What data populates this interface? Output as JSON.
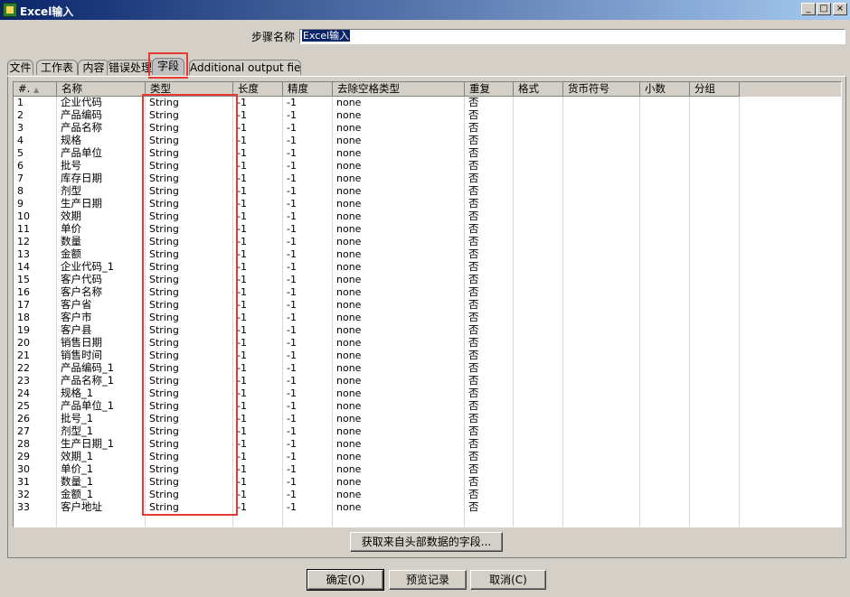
{
  "window": {
    "title": "Excel输入",
    "minimize": "_",
    "maximize": "□",
    "close": "×"
  },
  "step": {
    "label": "步骤名称",
    "value": "Excel输入"
  },
  "tabs": [
    "文件",
    "工作表",
    "内容",
    "错误处理",
    "字段",
    "Additional output fields"
  ],
  "active_tab": "字段",
  "grid": {
    "columns": [
      "#.",
      "名称",
      "类型",
      "长度",
      "精度",
      "去除空格类型",
      "重复",
      "格式",
      "货币符号",
      "小数",
      "分组"
    ],
    "rows": [
      [
        "1",
        "企业代码",
        "String",
        "-1",
        "-1",
        "none",
        "否"
      ],
      [
        "2",
        "产品编码",
        "String",
        "-1",
        "-1",
        "none",
        "否"
      ],
      [
        "3",
        "产品名称",
        "String",
        "-1",
        "-1",
        "none",
        "否"
      ],
      [
        "4",
        "规格",
        "String",
        "-1",
        "-1",
        "none",
        "否"
      ],
      [
        "5",
        "产品单位",
        "String",
        "-1",
        "-1",
        "none",
        "否"
      ],
      [
        "6",
        "批号",
        "String",
        "-1",
        "-1",
        "none",
        "否"
      ],
      [
        "7",
        "库存日期",
        "String",
        "-1",
        "-1",
        "none",
        "否"
      ],
      [
        "8",
        "剂型",
        "String",
        "-1",
        "-1",
        "none",
        "否"
      ],
      [
        "9",
        "生产日期",
        "String",
        "-1",
        "-1",
        "none",
        "否"
      ],
      [
        "10",
        "效期",
        "String",
        "-1",
        "-1",
        "none",
        "否"
      ],
      [
        "11",
        "单价",
        "String",
        "-1",
        "-1",
        "none",
        "否"
      ],
      [
        "12",
        "数量",
        "String",
        "-1",
        "-1",
        "none",
        "否"
      ],
      [
        "13",
        "金额",
        "String",
        "-1",
        "-1",
        "none",
        "否"
      ],
      [
        "14",
        "企业代码_1",
        "String",
        "-1",
        "-1",
        "none",
        "否"
      ],
      [
        "15",
        "客户代码",
        "String",
        "-1",
        "-1",
        "none",
        "否"
      ],
      [
        "16",
        "客户名称",
        "String",
        "-1",
        "-1",
        "none",
        "否"
      ],
      [
        "17",
        "客户省",
        "String",
        "-1",
        "-1",
        "none",
        "否"
      ],
      [
        "18",
        "客户市",
        "String",
        "-1",
        "-1",
        "none",
        "否"
      ],
      [
        "19",
        "客户县",
        "String",
        "-1",
        "-1",
        "none",
        "否"
      ],
      [
        "20",
        "销售日期",
        "String",
        "-1",
        "-1",
        "none",
        "否"
      ],
      [
        "21",
        "销售时间",
        "String",
        "-1",
        "-1",
        "none",
        "否"
      ],
      [
        "22",
        "产品编码_1",
        "String",
        "-1",
        "-1",
        "none",
        "否"
      ],
      [
        "23",
        "产品名称_1",
        "String",
        "-1",
        "-1",
        "none",
        "否"
      ],
      [
        "24",
        "规格_1",
        "String",
        "-1",
        "-1",
        "none",
        "否"
      ],
      [
        "25",
        "产品单位_1",
        "String",
        "-1",
        "-1",
        "none",
        "否"
      ],
      [
        "26",
        "批号_1",
        "String",
        "-1",
        "-1",
        "none",
        "否"
      ],
      [
        "27",
        "剂型_1",
        "String",
        "-1",
        "-1",
        "none",
        "否"
      ],
      [
        "28",
        "生产日期_1",
        "String",
        "-1",
        "-1",
        "none",
        "否"
      ],
      [
        "29",
        "效期_1",
        "String",
        "-1",
        "-1",
        "none",
        "否"
      ],
      [
        "30",
        "单价_1",
        "String",
        "-1",
        "-1",
        "none",
        "否"
      ],
      [
        "31",
        "数量_1",
        "String",
        "-1",
        "-1",
        "none",
        "否"
      ],
      [
        "32",
        "金额_1",
        "String",
        "-1",
        "-1",
        "none",
        "否"
      ],
      [
        "33",
        "客户地址",
        "String",
        "-1",
        "-1",
        "none",
        "否"
      ]
    ]
  },
  "get_fields_button": "获取来自头部数据的字段...",
  "buttons": {
    "ok": "确定(O)",
    "preview": "预览记录",
    "cancel": "取消(C)"
  },
  "colors": {
    "highlight": "#e53935",
    "title_bar": "#0a246a"
  }
}
